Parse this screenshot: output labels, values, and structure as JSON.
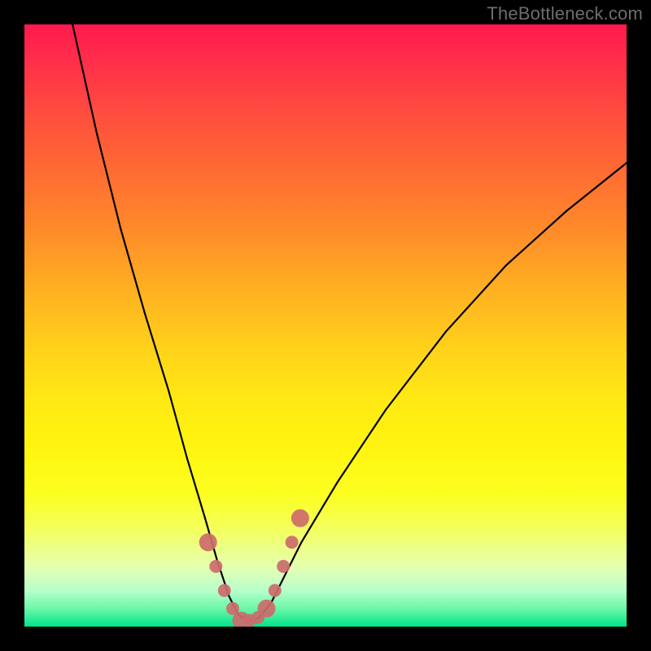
{
  "watermark": "TheBottleneck.com",
  "chart_data": {
    "type": "line",
    "title": "",
    "xlabel": "",
    "ylabel": "",
    "xlim": [
      0,
      100
    ],
    "ylim": [
      0,
      100
    ],
    "grid": false,
    "legend": false,
    "series": [
      {
        "name": "bottleneck-curve",
        "x": [
          8,
          12,
          16,
          20,
          24,
          27,
          30,
          32,
          34,
          35.5,
          37,
          39,
          41,
          43,
          46,
          52,
          60,
          70,
          80,
          90,
          100
        ],
        "y": [
          100,
          82,
          66,
          52,
          39,
          28,
          18,
          11,
          5,
          2,
          1,
          1.5,
          4,
          8,
          14,
          24,
          36,
          49,
          60,
          69,
          77
        ]
      }
    ],
    "markers": {
      "name": "highlight-points",
      "color": "#cc6b6d",
      "x": [
        30.5,
        31.8,
        33.2,
        34.6,
        36.0,
        37.4,
        38.8,
        40.2,
        41.6,
        43.0,
        44.4,
        45.8
      ],
      "y": [
        14,
        10,
        6,
        3,
        1,
        1,
        1.5,
        3,
        6,
        10,
        14,
        18
      ],
      "notable_large": [
        0,
        4,
        7,
        11
      ]
    },
    "background": {
      "type": "gradient",
      "direction": "vertical",
      "stops": [
        {
          "pos": 0,
          "color": "#ff1a4d"
        },
        {
          "pos": 50,
          "color": "#ffd21a"
        },
        {
          "pos": 100,
          "color": "#00e48a"
        }
      ]
    }
  }
}
